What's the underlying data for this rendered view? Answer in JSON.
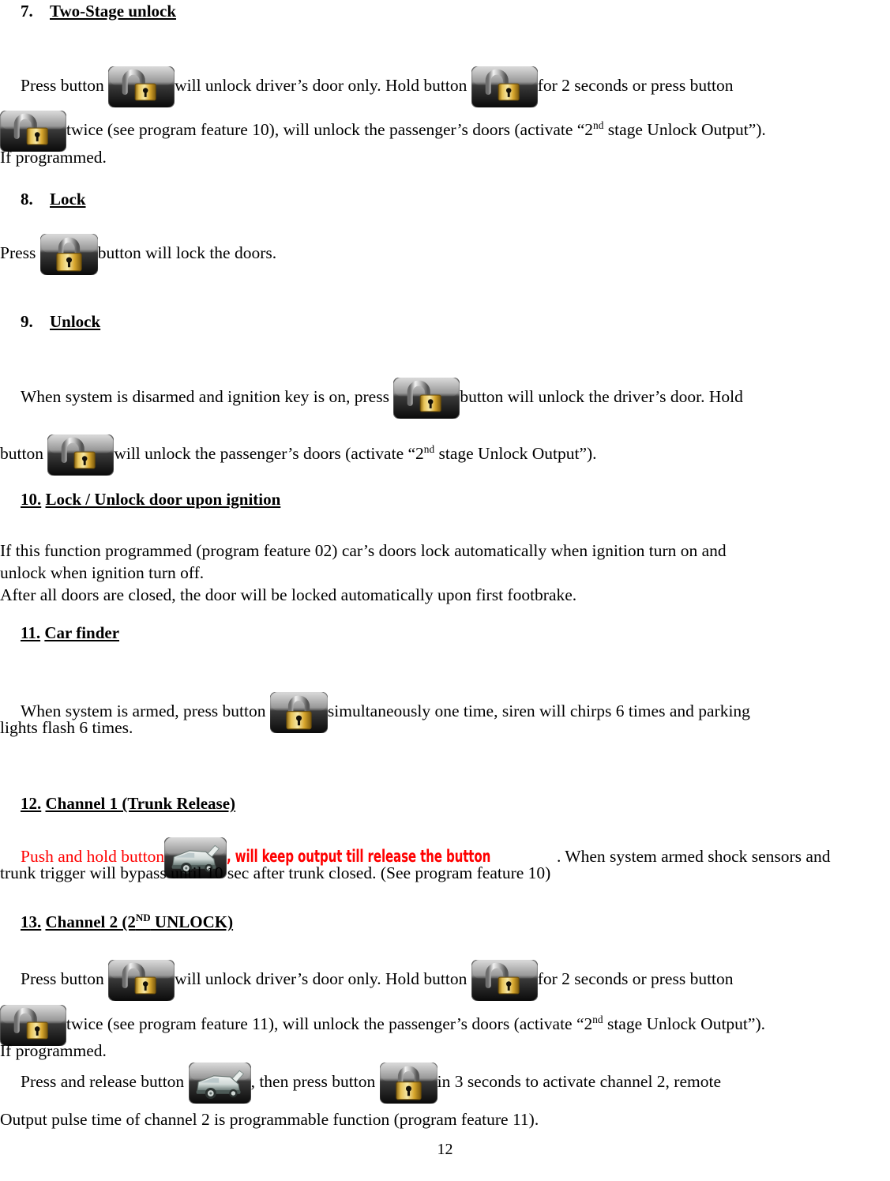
{
  "document": {
    "page_number": "12",
    "colors": {
      "text": "#000000",
      "highlight": "#ff0000"
    }
  },
  "sections": [
    {
      "number": "7.",
      "title": "Two-Stage unlock",
      "number_underlined": false,
      "body": {
        "p1_a": "Press button",
        "p1_b": "will unlock driver’s door only. Hold button",
        "p1_c": "for 2 seconds or press button",
        "p2_a": "twice (see program feature 10), will unlock the passenger’s doors (activate “2",
        "p2_sup": "nd",
        "p2_b": " stage Unlock Output”).",
        "p3": "If programmed."
      }
    },
    {
      "number": "8.",
      "title": "Lock",
      "number_underlined": false,
      "body": {
        "p1_a": "Press",
        "p1_b": "button will lock the doors."
      }
    },
    {
      "number": "9.",
      "title": "Unlock",
      "number_underlined": false,
      "body": {
        "p1_a": "When system is disarmed and ignition key is on, press",
        "p1_b": "button will unlock the driver’s door. Hold",
        "p2_a": "button",
        "p2_b": "will unlock the passenger’s doors (activate “2",
        "p2_sup": "nd",
        "p2_c": " stage Unlock Output”)."
      }
    },
    {
      "number": "10.",
      "title": "Lock / Unlock door upon ignition",
      "number_underlined": true,
      "body": {
        "p1": "If this function programmed (program feature 02) car’s doors lock automatically when ignition turn on and",
        "p2": "unlock when ignition turn off.",
        "p3": "After all doors are closed, the door will be locked automatically upon first footbrake."
      }
    },
    {
      "number": "11.",
      "title": "Car finder",
      "number_underlined": true,
      "body": {
        "p1_a": "When system is armed, press button",
        "p1_b": "simultaneously one time, siren will chirps 6 times and parking",
        "p2": "lights flash 6 times."
      }
    },
    {
      "number": "12.",
      "title": "Channel 1 (Trunk Release)",
      "number_underlined": true,
      "body": {
        "p1_a": "Push and hold button",
        "p1_red": ", will keep output till release the button",
        "p1_b": ". When system armed shock sensors and",
        "p2": "trunk trigger will bypass until 10 sec after trunk closed. (See program feature   10)"
      }
    },
    {
      "number": "13.",
      "title_a": "Channel 2 (2",
      "title_sup": "ND",
      "title_b": "  UNLOCK)",
      "number_underlined": true,
      "body": {
        "p1_a": "Press button",
        "p1_b": "will unlock driver’s door only. Hold button",
        "p1_c": "for 2 seconds or press button",
        "p2_a": "twice (see program feature 11), will unlock the passenger’s doors (activate “2",
        "p2_sup": "nd",
        "p2_b": " stage Unlock Output”).",
        "p3": "If programmed.",
        "p4_a": "Press and release button",
        "p4_b": ", then press button",
        "p4_c": "in 3 seconds  to activate channel 2, remote",
        "p5": "Output pulse time of channel 2 is programmable function (program feature  11)."
      }
    }
  ],
  "icons": {
    "unlock": "unlock-button-icon",
    "lock": "lock-button-icon",
    "trunk": "trunk-release-button-icon"
  }
}
